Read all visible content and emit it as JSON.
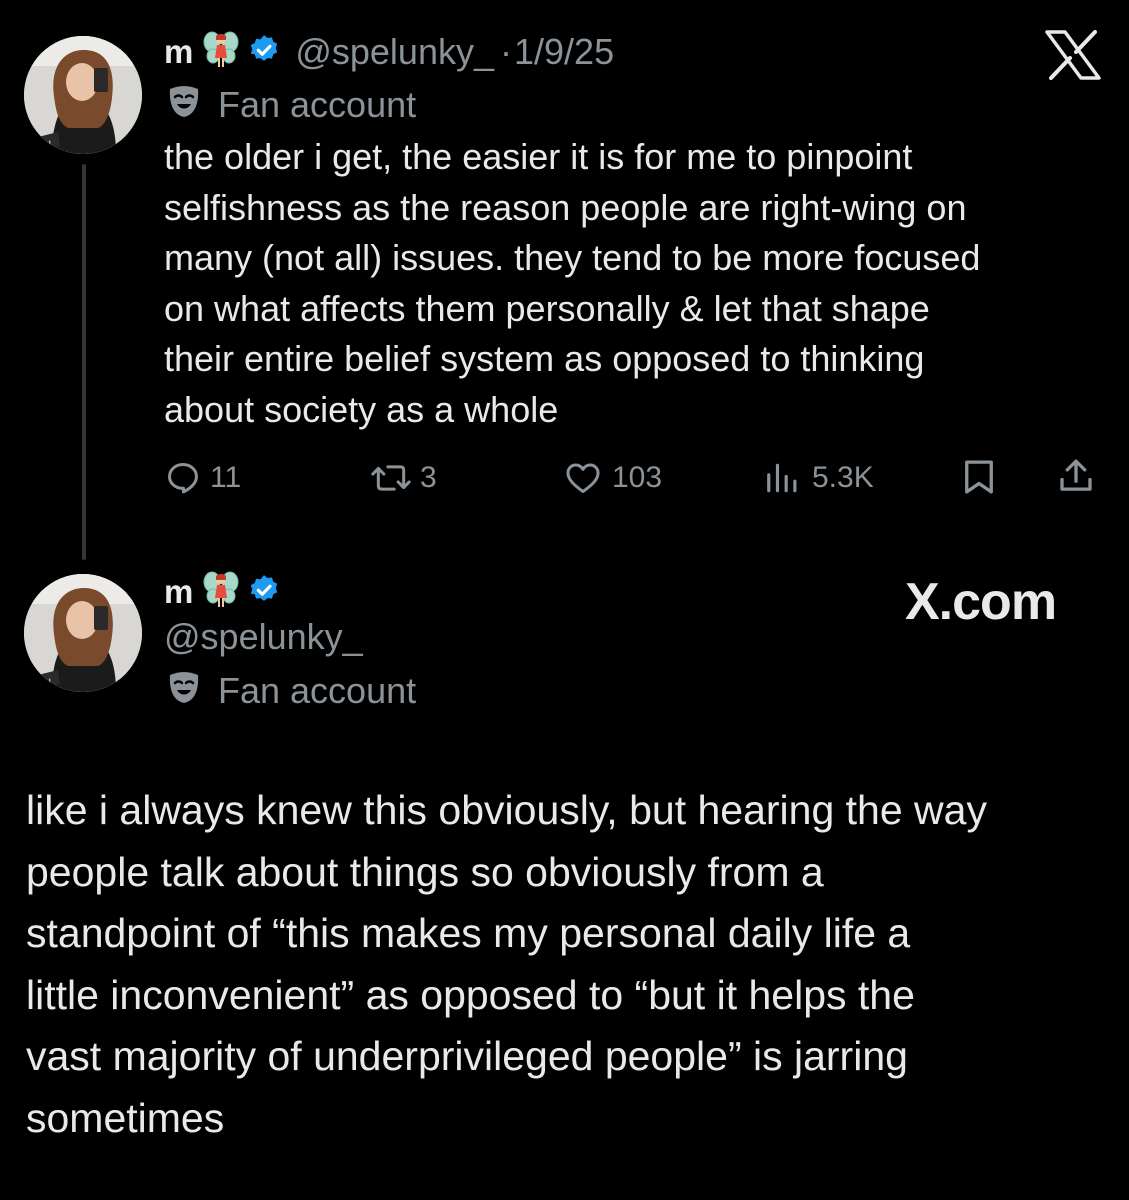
{
  "tweet": {
    "display_name": "m",
    "handle": "@spelunky_",
    "separator": "·",
    "date": "1/9/25",
    "label": "Fan account",
    "text": "the older i get, the easier it is for me to pinpoint selfishness as the reason people are right-wing on many (not all) issues. they tend to be more focused on what affects them personally & let that shape their entire belief system as opposed to thinking about society as a whole",
    "text_lines": [
      "the older i get, the easier it is for me to pinpoint",
      "selfishness as the reason people are right-wing on",
      "many (not all) issues. they tend to be more focused",
      "on what affects them personally & let that shape",
      "their entire belief system as opposed to thinking",
      "about society as a whole"
    ],
    "metrics": {
      "replies": "11",
      "reposts": "3",
      "likes": "103",
      "views": "5.3K"
    }
  },
  "reply": {
    "display_name": "m",
    "handle": "@spelunky_",
    "label": "Fan account",
    "site": "X.com",
    "text_lines": [
      "like i always knew this obviously, but hearing the way",
      "people talk about things so obviously from a",
      "standpoint of “this makes my personal daily life a",
      "little inconvenient” as opposed to “but it helps the",
      "vast majority of underprivileged people” is jarring",
      "sometimes"
    ]
  },
  "colors": {
    "background": "#000000",
    "text_primary": "#e7e9ea",
    "text_secondary": "#8b9298",
    "verified_blue": "#1d9bf0"
  },
  "icons": [
    "x-logo-icon",
    "fairy-emoji-icon",
    "verified-badge-icon",
    "mask-icon",
    "reply-icon",
    "repost-icon",
    "like-icon",
    "views-icon",
    "bookmark-icon",
    "share-icon"
  ]
}
